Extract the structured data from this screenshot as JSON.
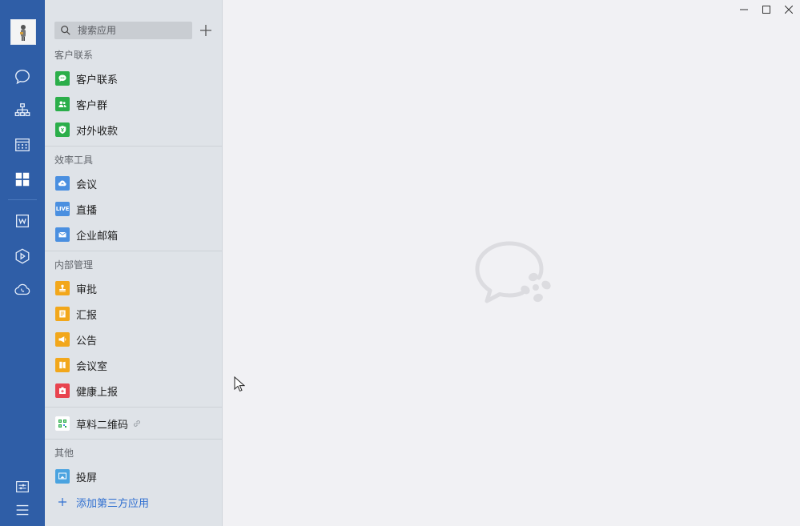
{
  "search": {
    "placeholder": "搜索应用"
  },
  "sections": {
    "customer": {
      "title": "客户联系",
      "items": [
        "客户联系",
        "客户群",
        "对外收款"
      ]
    },
    "efficiency": {
      "title": "效率工具",
      "items": [
        "会议",
        "直播",
        "企业邮箱"
      ]
    },
    "internal": {
      "title": "内部管理",
      "items": [
        "审批",
        "汇报",
        "公告",
        "会议室",
        "健康上报"
      ]
    },
    "custom": {
      "items": [
        "草料二维码"
      ]
    },
    "other": {
      "title": "其他",
      "items": [
        "投屏"
      ],
      "add_third_party": "添加第三方应用"
    }
  },
  "icons": {
    "live_text": "LIVE"
  },
  "colors": {
    "rail": "#2f5ea7",
    "panel": "#dfe3e8",
    "main": "#f1f1f4",
    "green": "#2bae4a",
    "blue": "#4a8fe0",
    "orange": "#f2a71b",
    "red": "#e8434f",
    "link": "#2f6fd0"
  }
}
